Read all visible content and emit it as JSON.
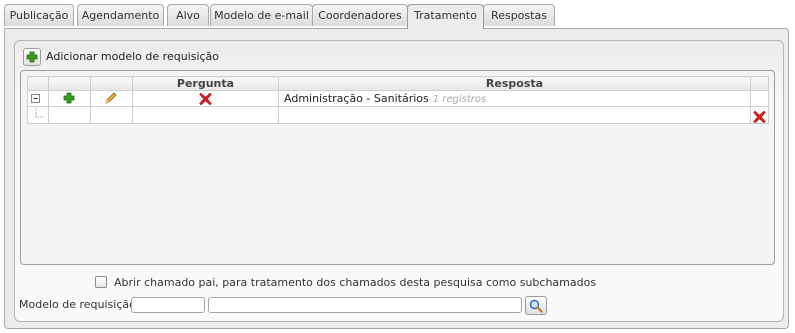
{
  "tabs": [
    {
      "label": "Publicação",
      "active": false
    },
    {
      "label": "Agendamento",
      "active": false
    },
    {
      "label": "Alvo",
      "active": false
    },
    {
      "label": "Modelo de e-mail",
      "active": false
    },
    {
      "label": "Coordenadores",
      "active": false
    },
    {
      "label": "Tratamento",
      "active": true
    },
    {
      "label": "Respostas",
      "active": false
    }
  ],
  "toolbar": {
    "add_label": "Adicionar modelo de requisição",
    "add_icon": "plus-icon"
  },
  "grid": {
    "columns": [
      "",
      "",
      "",
      "Pergunta",
      "Resposta",
      ""
    ],
    "rows": [
      {
        "expand_icon": "collapse-icon",
        "add_icon": "plus-icon",
        "edit_icon": "pencil-icon",
        "delete_icon": "delete-icon",
        "response": "Administração - Sanitários",
        "response_count": "1 registros"
      },
      {
        "delete_icon": "delete-icon",
        "response": ""
      }
    ]
  },
  "options": {
    "open_parent_label": "Abrir chamado pai, para tratamento dos chamados desta pesquisa como subchamados",
    "open_parent_checked": false
  },
  "model_field": {
    "label": "Modelo de requisição:",
    "code_value": "",
    "name_value": "",
    "search_icon": "magnifier-icon"
  },
  "colors": {
    "add_green": "#3a9a1c",
    "delete_red": "#d42020",
    "pencil_orange": "#e8a020"
  }
}
